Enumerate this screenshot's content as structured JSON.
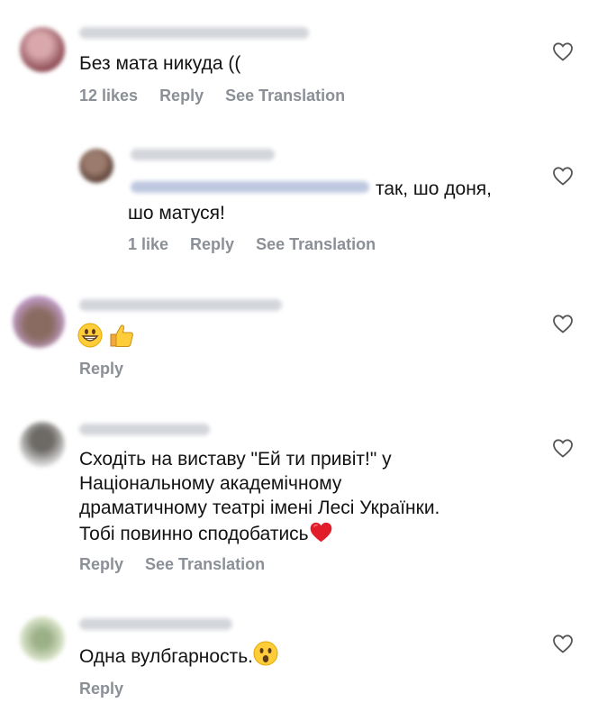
{
  "comments": [
    {
      "text": "Без мата никуда ((",
      "likes": "12 likes",
      "reply": "Reply",
      "translate": "See Translation",
      "avatar_colors": [
        "#d8a8ad",
        "#8c4a52"
      ]
    },
    {
      "text_line1": "так, шо доня,",
      "text_line2": "шо матуся!",
      "likes": "1 like",
      "reply": "Reply",
      "translate": "See Translation",
      "avatar_colors": [
        "#9b7b6d",
        "#4a3028"
      ]
    },
    {
      "reply": "Reply",
      "emoji": [
        "grinning-face-emoji",
        "thumbs-up-emoji"
      ],
      "avatar_colors": [
        "#c9a3d6",
        "#8a6b62"
      ]
    },
    {
      "text_lines": [
        "Сходіть на виставу \"Ей ти привіт!\" у",
        "Національному академічному",
        "драматичному театрі імені Лесі Українки.",
        "Тобі повинно сподобатись"
      ],
      "reply": "Reply",
      "translate": "See Translation",
      "emoji": [
        "red-heart-emoji"
      ],
      "avatar_colors": [
        "#d8d8d8",
        "#6d6a66"
      ]
    },
    {
      "text": "Одна вулбгарность.",
      "reply": "Reply",
      "emoji": [
        "face-open-mouth-emoji"
      ],
      "avatar_colors": [
        "#dfe8d0",
        "#9bb087"
      ]
    }
  ]
}
